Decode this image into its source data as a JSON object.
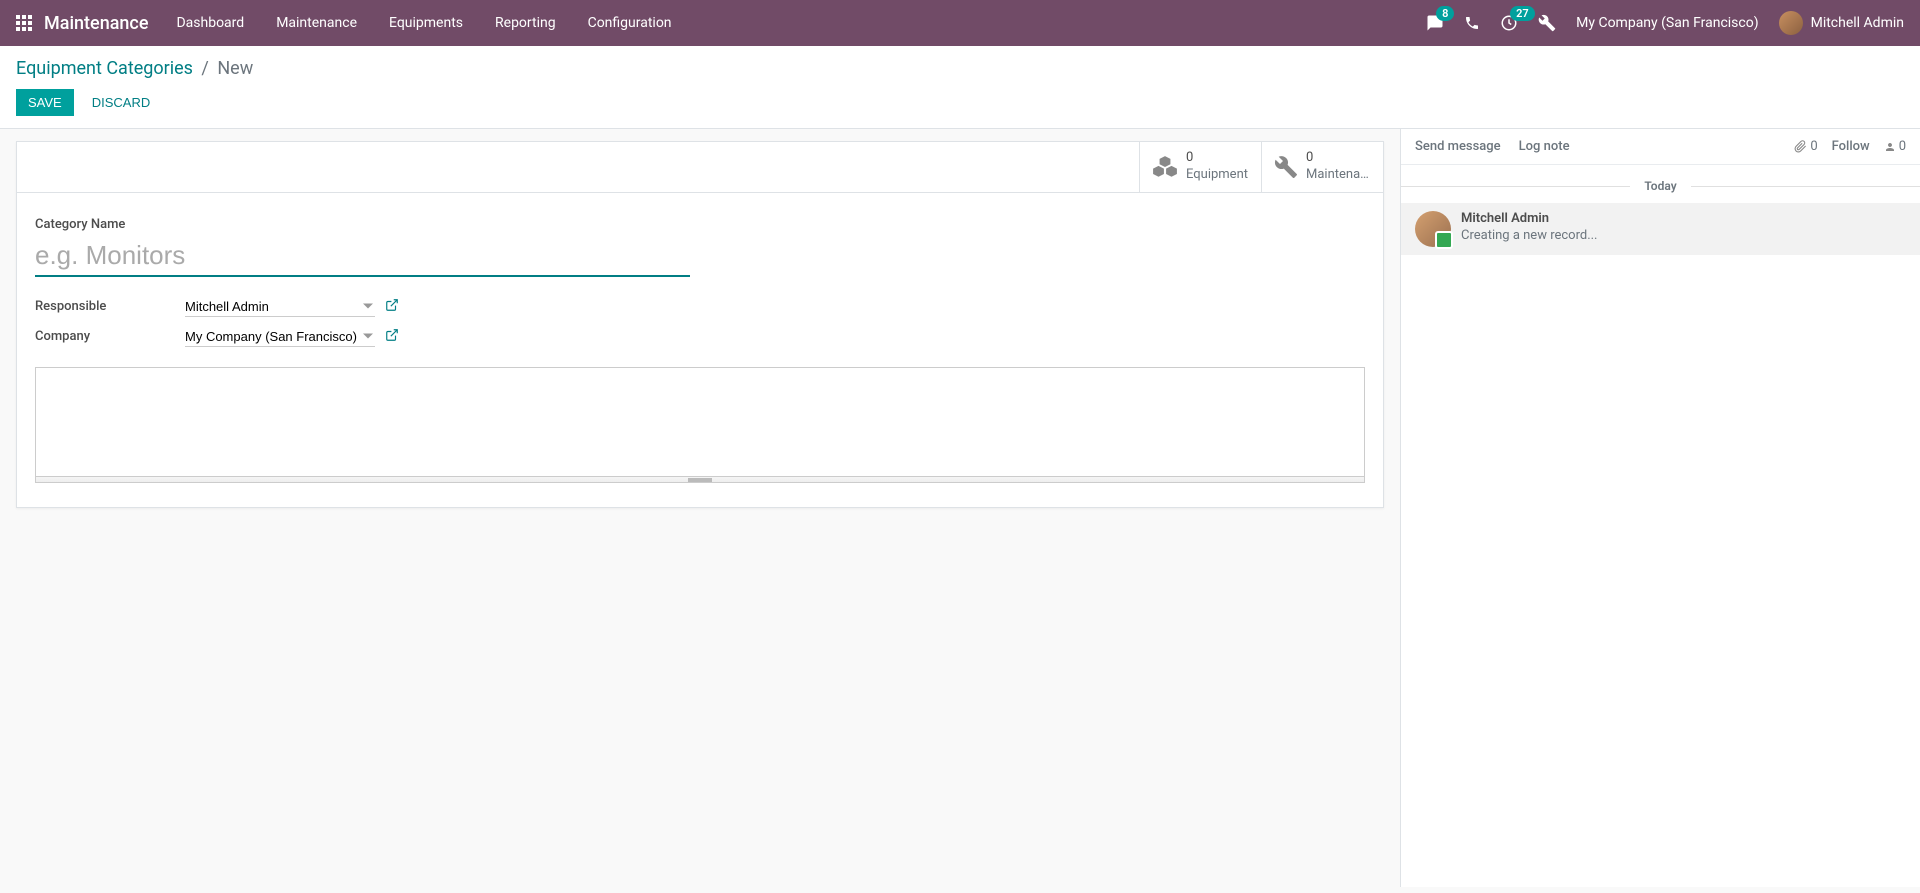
{
  "nav": {
    "brand": "Maintenance",
    "menu": [
      "Dashboard",
      "Maintenance",
      "Equipments",
      "Reporting",
      "Configuration"
    ],
    "messaging_badge": "8",
    "activities_badge": "27",
    "company": "My Company (San Francisco)",
    "user": "Mitchell Admin"
  },
  "breadcrumb": {
    "parent": "Equipment Categories",
    "current": "New"
  },
  "buttons": {
    "save": "Save",
    "discard": "Discard"
  },
  "stat_buttons": {
    "equipment": {
      "count": "0",
      "label": "Equipment"
    },
    "maintenance": {
      "count": "0",
      "label": "Maintenan..."
    }
  },
  "form": {
    "category_label": "Category Name",
    "category_placeholder": "e.g. Monitors",
    "responsible_label": "Responsible",
    "responsible_value": "Mitchell Admin",
    "company_label": "Company",
    "company_value": "My Company (San Francisco)"
  },
  "chatter": {
    "send_message": "Send message",
    "log_note": "Log note",
    "attachments": "0",
    "follow": "Follow",
    "followers": "0",
    "date": "Today",
    "messages": [
      {
        "author": "Mitchell Admin",
        "body": "Creating a new record..."
      }
    ]
  }
}
